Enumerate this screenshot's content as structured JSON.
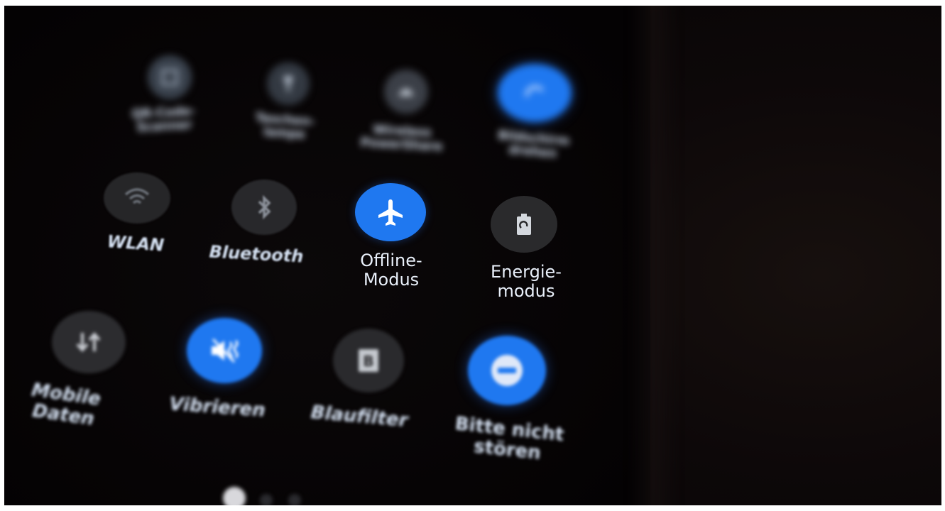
{
  "quick_settings": {
    "row1": [
      {
        "label_line1": "QR-Code-",
        "label_line2": "Scanner",
        "icon": "qr-scanner-icon",
        "active": false
      },
      {
        "label_line1": "Taschen-",
        "label_line2": "lampe",
        "icon": "flashlight-icon",
        "active": false
      },
      {
        "label_line1": "Wireless",
        "label_line2": "PowerShare",
        "icon": "powershare-icon",
        "active": false
      },
      {
        "label_line1": "Bildschirm",
        "label_line2": "drehen",
        "icon": "rotate-screen-icon",
        "active": true
      }
    ],
    "row2": [
      {
        "label_line1": "WLAN",
        "label_line2": "",
        "icon": "wifi-icon",
        "active": false
      },
      {
        "label_line1": "Bluetooth",
        "label_line2": "",
        "icon": "bluetooth-icon",
        "active": false
      },
      {
        "label_line1": "Offline-",
        "label_line2": "Modus",
        "icon": "airplane-icon",
        "active": true
      },
      {
        "label_line1": "Energie-",
        "label_line2": "modus",
        "icon": "battery-saver-icon",
        "active": false
      }
    ],
    "row3": [
      {
        "label_line1": "Mobile",
        "label_line2": "Daten",
        "icon": "mobile-data-icon",
        "active": false
      },
      {
        "label_line1": "Vibrieren",
        "label_line2": "",
        "icon": "vibrate-icon",
        "active": true
      },
      {
        "label_line1": "Blaufilter",
        "label_line2": "",
        "icon": "blue-light-filter-icon",
        "active": false
      },
      {
        "label_line1": "Bitte nicht",
        "label_line2": "stören",
        "icon": "do-not-disturb-icon",
        "active": true
      }
    ]
  },
  "pagination": {
    "pages": 3,
    "current": 1
  },
  "colors": {
    "active": "#1f78f0",
    "inactive": "#2b2b2e",
    "label": "#d6e2f3",
    "background": "#050304"
  }
}
